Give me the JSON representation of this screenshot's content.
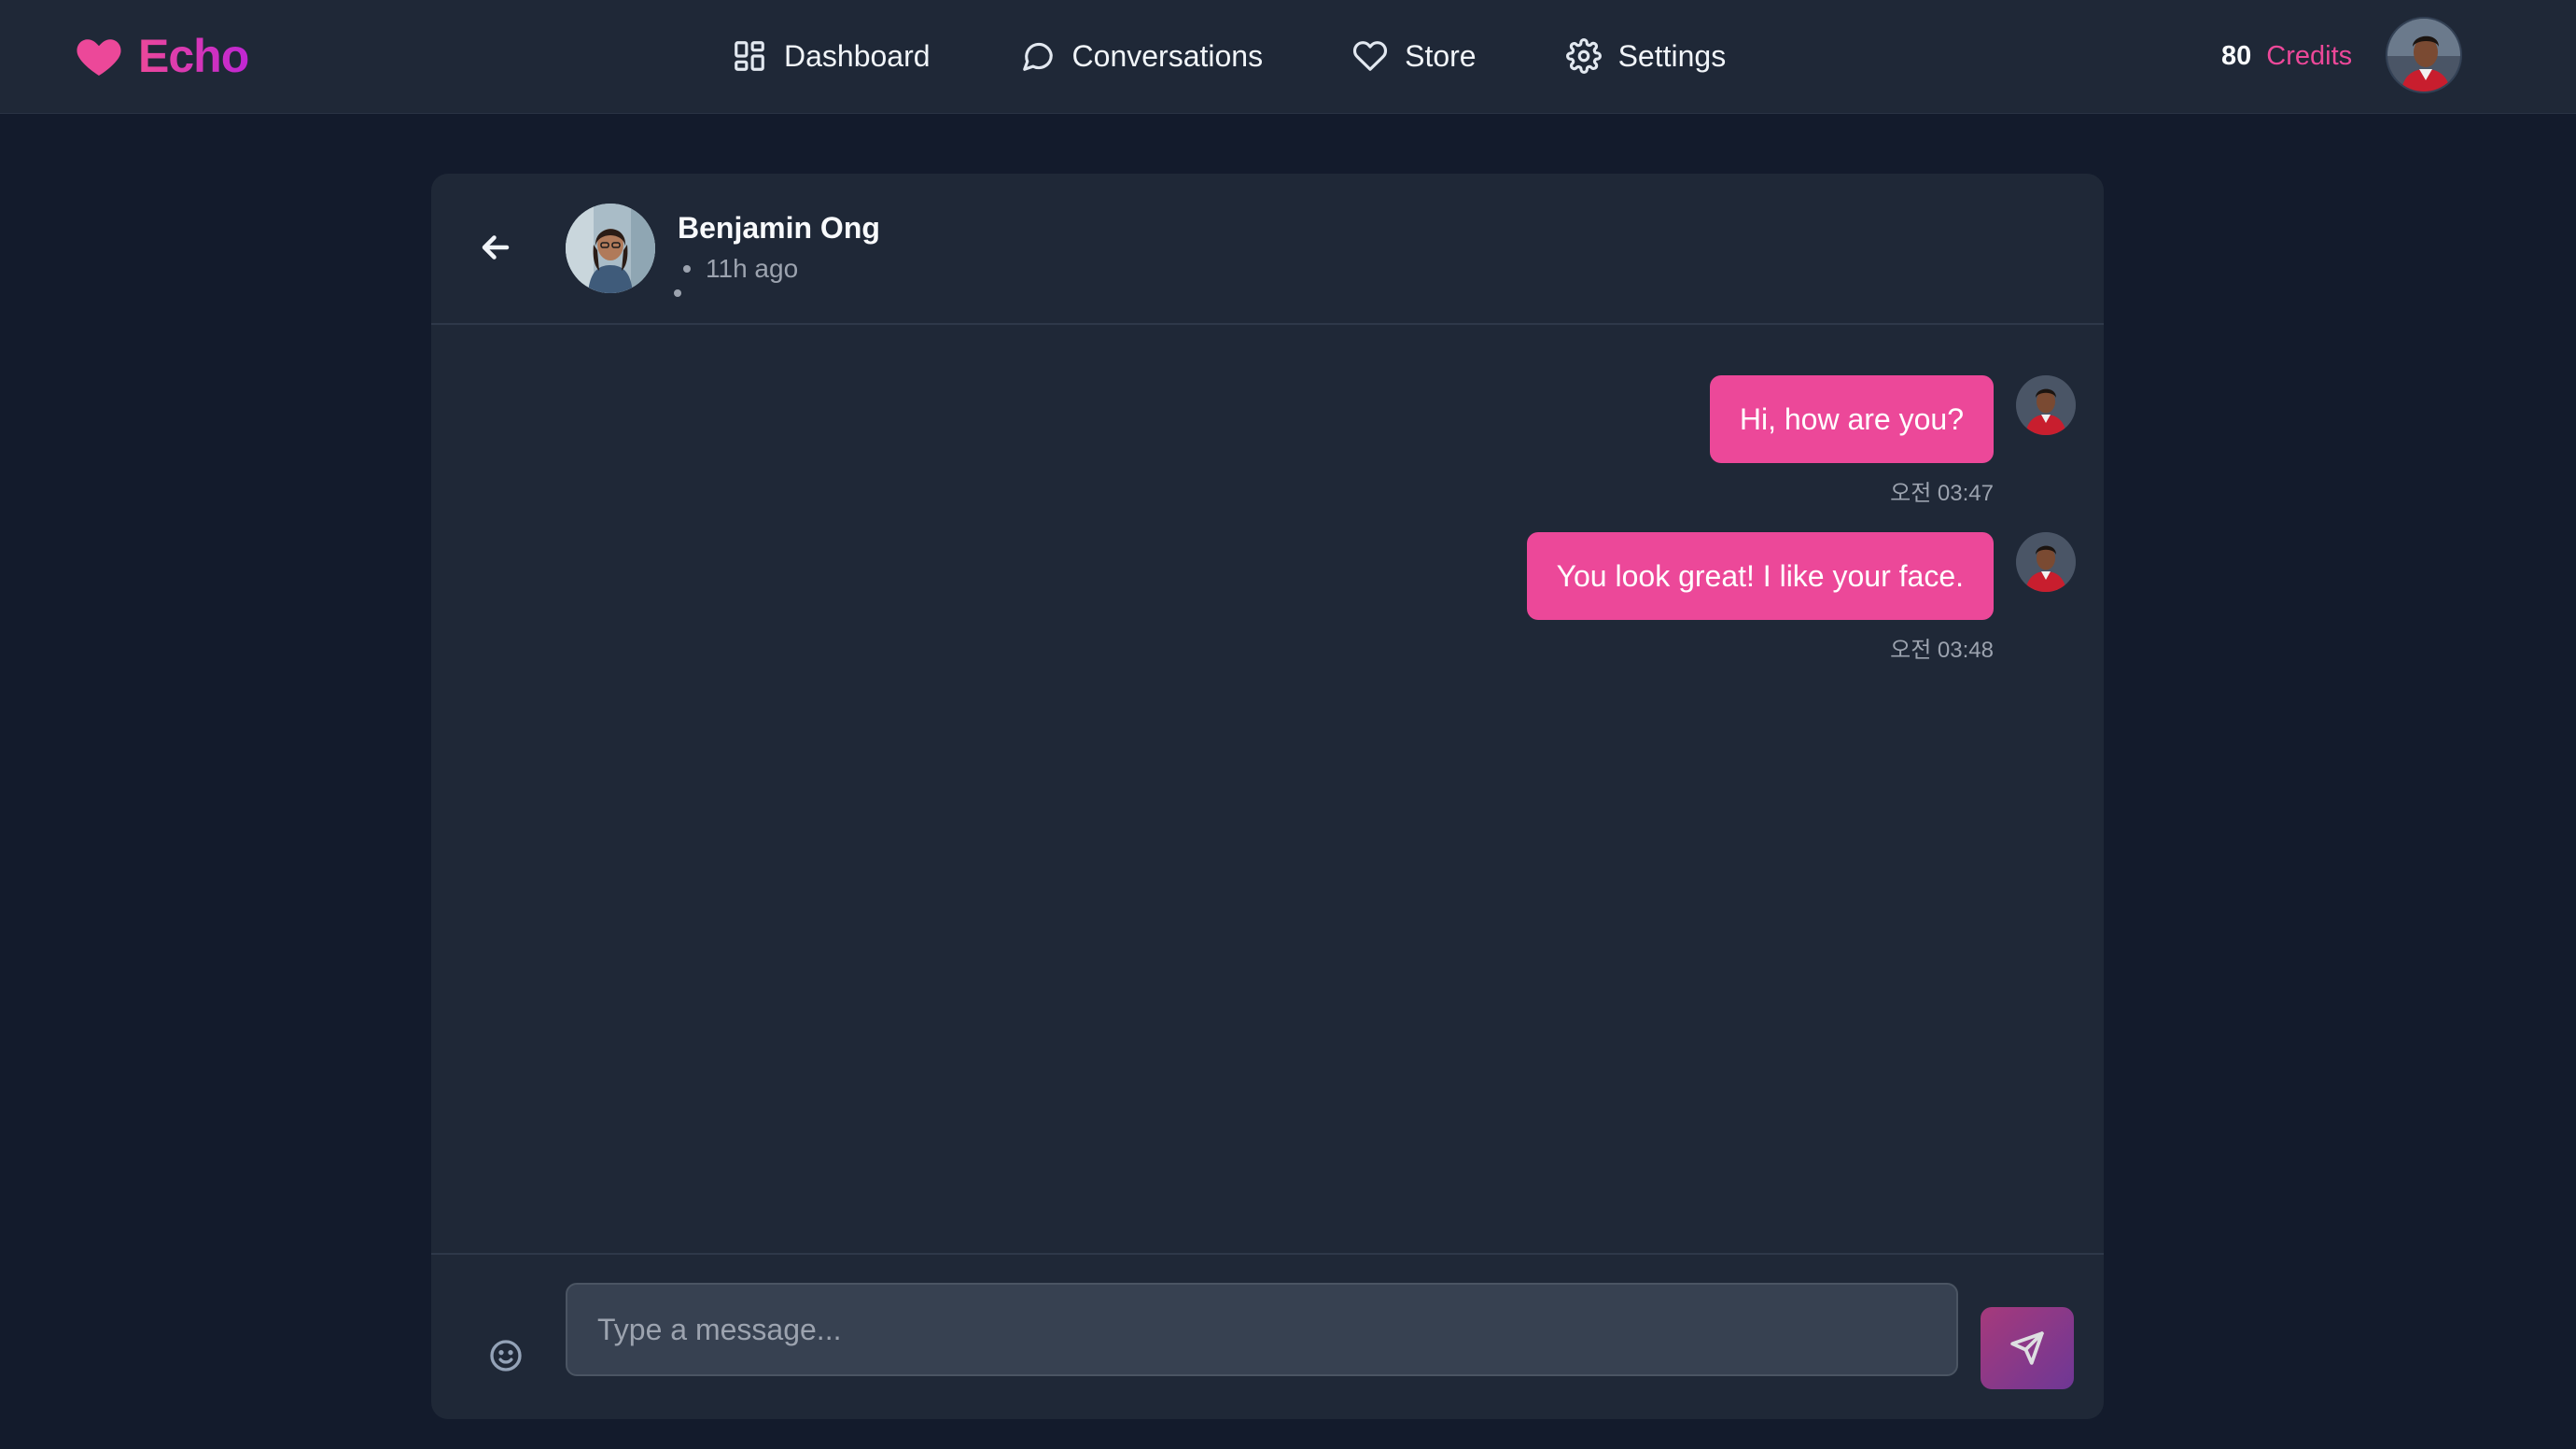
{
  "brand": {
    "name": "Echo",
    "icon": "heart-icon",
    "accent": "#ec4899"
  },
  "nav": [
    {
      "label": "Dashboard",
      "icon": "grid-icon"
    },
    {
      "label": "Conversations",
      "icon": "chat-bubble-icon"
    },
    {
      "label": "Store",
      "icon": "heart-outline-icon"
    },
    {
      "label": "Settings",
      "icon": "gear-icon"
    }
  ],
  "credits": {
    "amount": "80",
    "label": "Credits"
  },
  "chat": {
    "contact": {
      "name": "Benjamin Ong",
      "last_seen": "11h ago"
    },
    "messages": [
      {
        "text": "Hi, how are you?",
        "time": "오전 03:47",
        "from": "me"
      },
      {
        "text": "You look great! I like your face.",
        "time": "오전 03:48",
        "from": "me"
      }
    ],
    "input": {
      "placeholder": "Type a message...",
      "value": ""
    }
  },
  "colors": {
    "background": "#131b2c",
    "surface": "#1f2837",
    "bubble": "#ec4899"
  }
}
